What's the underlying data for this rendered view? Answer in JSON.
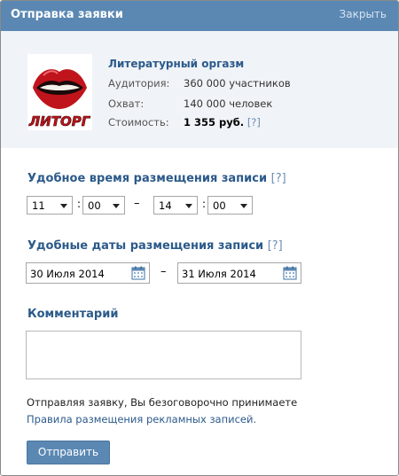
{
  "header": {
    "title": "Отправка заявки",
    "close_label": "Закрыть"
  },
  "community": {
    "name": "Литературный оргазм",
    "logo_text": "ЛИТОРГ",
    "audience_label": "Аудитория:",
    "audience_value": "360 000 участников",
    "reach_label": "Охват:",
    "reach_value": "140 000 человек",
    "price_label": "Стоимость:",
    "price_value": "1 355 руб.",
    "help": "[?]"
  },
  "time_section": {
    "title": "Удобное время размещения записи",
    "help": "[?]",
    "from_hour": "11",
    "from_minute": "00",
    "to_hour": "14",
    "to_minute": "00",
    "colon": ":",
    "dash": "–"
  },
  "date_section": {
    "title": "Удобные даты размещения записи",
    "help": "[?]",
    "from_date": "30 Июля 2014",
    "to_date": "31 Июля 2014",
    "dash": "–"
  },
  "comment_section": {
    "title": "Комментарий"
  },
  "footer": {
    "note": "Отправляя заявку, Вы безоговорочно принимаете",
    "rules_link": "Правила размещения рекламных записей.",
    "submit_label": "Отправить"
  },
  "colors": {
    "header_bg": "#5b88b3",
    "info_bg": "#f0f3f7",
    "link": "#2b5a8a"
  }
}
